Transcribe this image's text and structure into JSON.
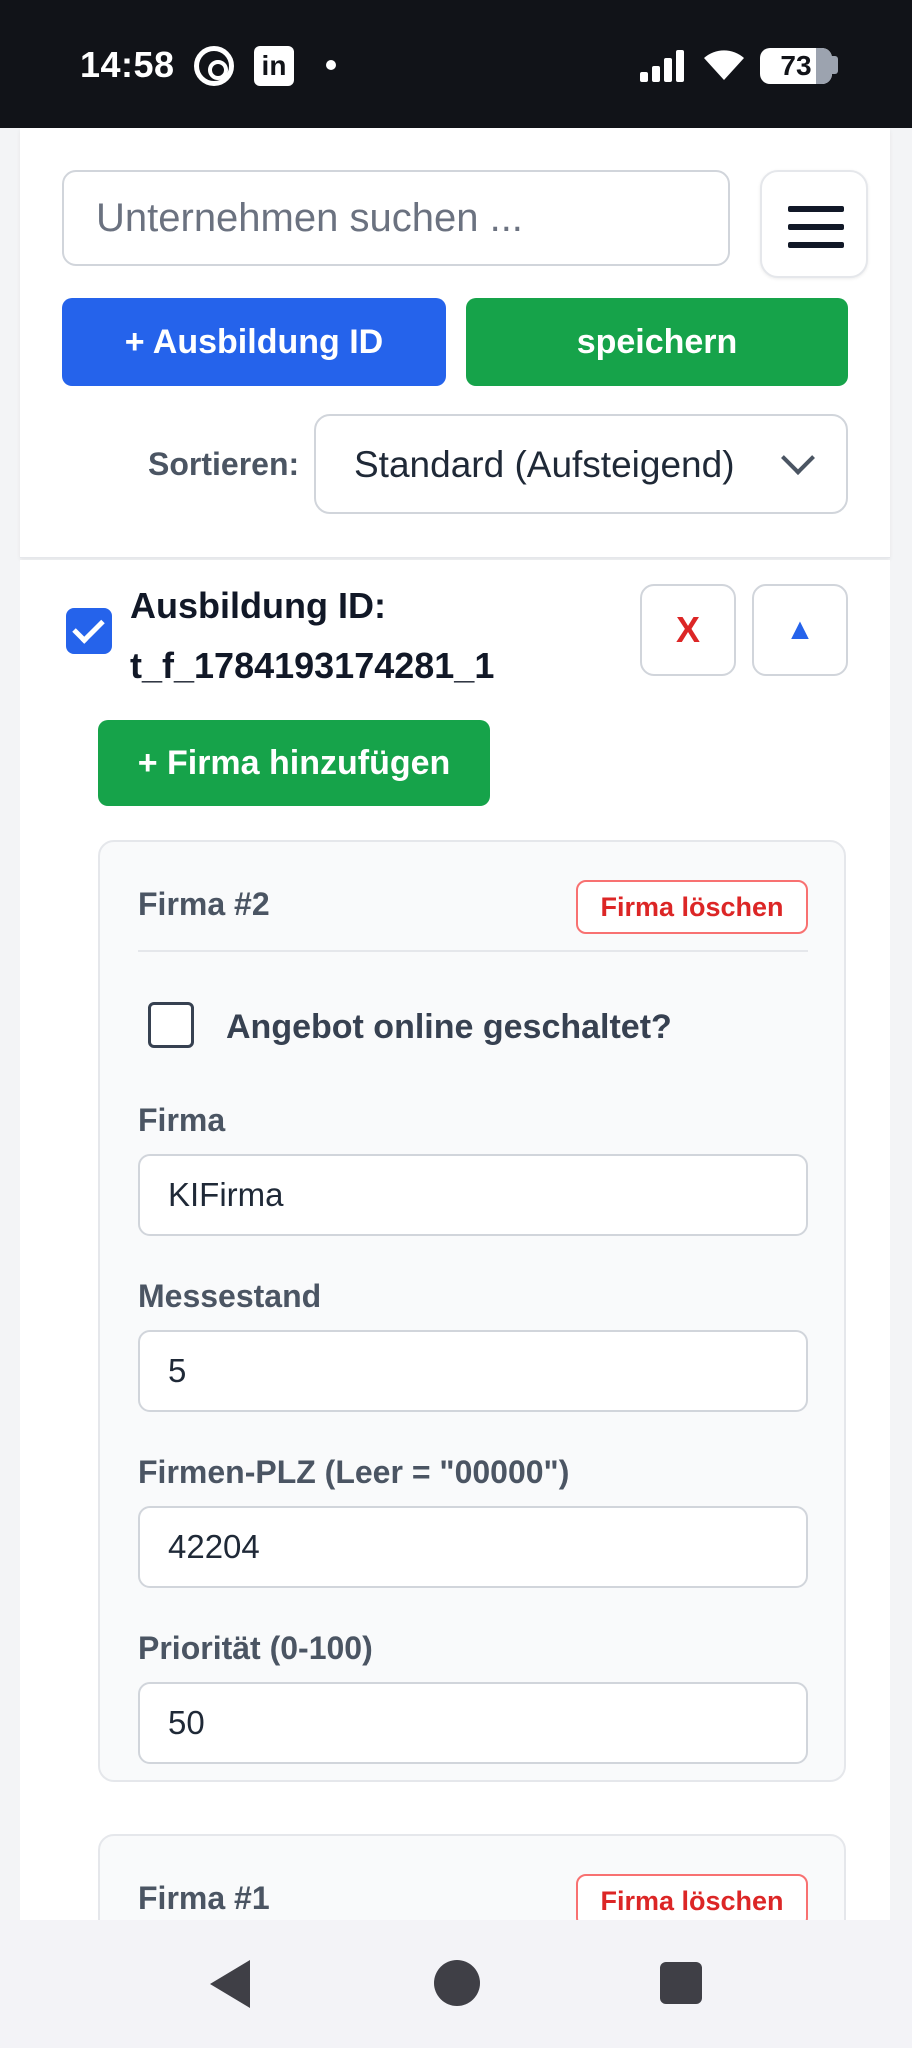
{
  "status_bar": {
    "time": "14:58",
    "battery": "73",
    "icons": [
      "threads-icon",
      "linkedin-icon",
      "notification-dot-icon",
      "signal-icon",
      "wifi-icon",
      "battery-icon"
    ]
  },
  "header": {
    "search_placeholder": "Unternehmen suchen ...",
    "add_id_label": "+ Ausbildung ID",
    "save_label": "speichern",
    "sort_label": "Sortieren:",
    "sort_value": "Standard (Aufsteigend)"
  },
  "entry": {
    "title_line1": "Ausbildung ID:",
    "title_line2": "t_f_1784193174281_1",
    "checked": true,
    "delete_label": "X",
    "collapse_label": "▲",
    "add_firma_label": "+ Firma hinzufügen"
  },
  "firmen": [
    {
      "title": "Firma #2",
      "delete_label": "Firma löschen",
      "online_label": "Angebot online geschaltet?",
      "online_checked": false,
      "fields": [
        {
          "label": "Firma",
          "value": "KIFirma"
        },
        {
          "label": "Messestand",
          "value": "5"
        },
        {
          "label": "Firmen-PLZ (Leer = \"00000\")",
          "value": "42204"
        },
        {
          "label": "Priorität (0-100)",
          "value": "50"
        }
      ]
    },
    {
      "title": "Firma #1",
      "delete_label": "Firma löschen"
    }
  ],
  "colors": {
    "primary_blue": "#2563eb",
    "success_green": "#16a34a",
    "danger_red": "#dc2626"
  }
}
